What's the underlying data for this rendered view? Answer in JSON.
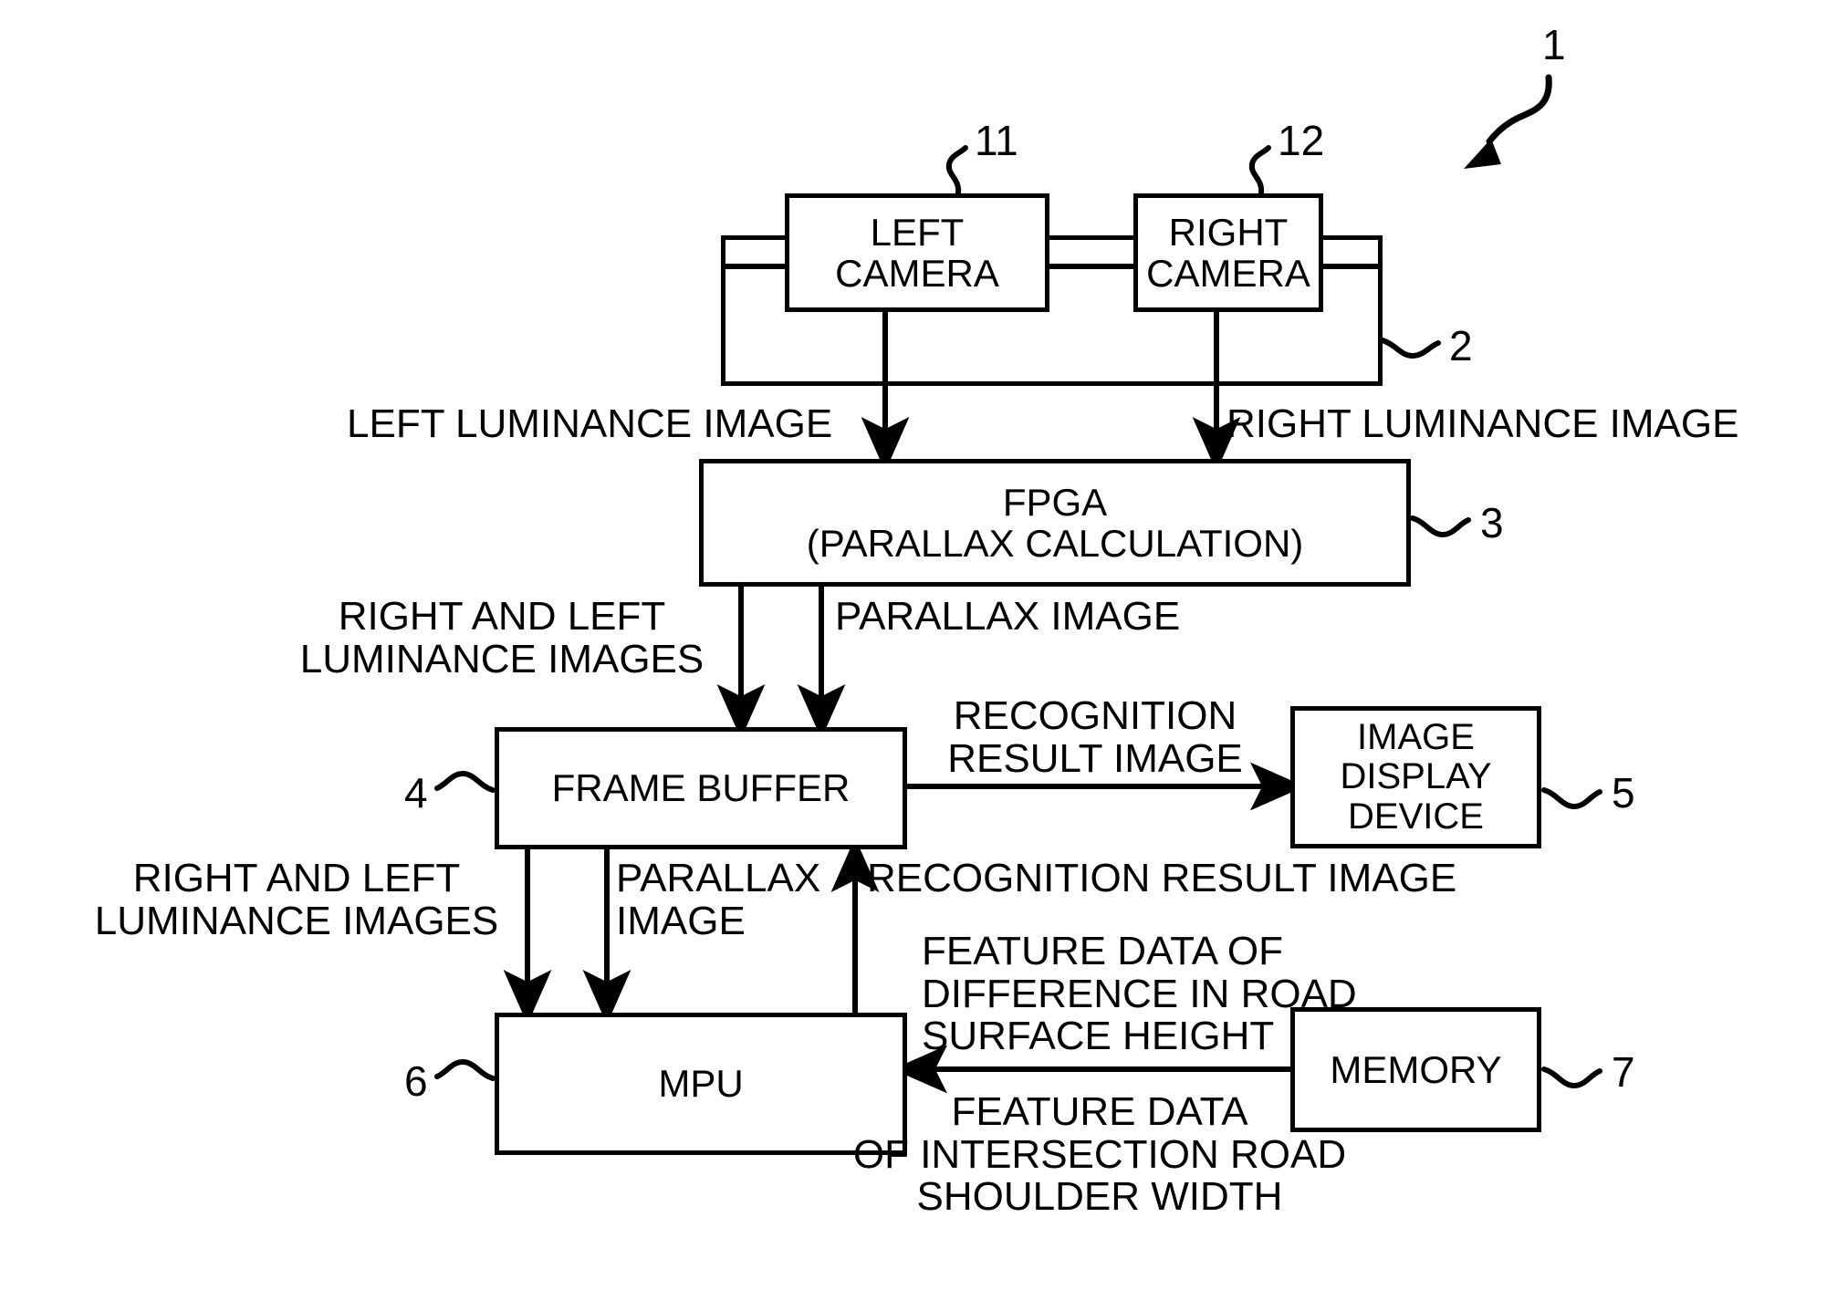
{
  "figure": {
    "system_ref": "1",
    "camera_unit_ref": "2",
    "fpga_ref": "3",
    "frame_buffer_ref": "4",
    "display_ref": "5",
    "mpu_ref": "6",
    "memory_ref": "7",
    "left_camera_ref": "11",
    "right_camera_ref": "12"
  },
  "blocks": {
    "left_camera": {
      "line1": "LEFT",
      "line2": "CAMERA"
    },
    "right_camera": {
      "line1": "RIGHT",
      "line2": "CAMERA"
    },
    "fpga": {
      "line1": "FPGA",
      "line2": "(PARALLAX CALCULATION)"
    },
    "frame_buffer": {
      "line1": "FRAME BUFFER"
    },
    "image_display_device": {
      "line1": "IMAGE",
      "line2": "DISPLAY",
      "line3": "DEVICE"
    },
    "mpu": {
      "line1": "MPU"
    },
    "memory": {
      "line1": "MEMORY"
    }
  },
  "edge_labels": {
    "left_luminance_image": "LEFT LUMINANCE IMAGE",
    "right_luminance_image": "RIGHT LUMINANCE IMAGE",
    "right_and_left_luminance_images_top": "RIGHT AND LEFT\nLUMINANCE IMAGES",
    "parallax_image_top": "PARALLAX IMAGE",
    "recognition_result_image_to_display": "RECOGNITION\nRESULT IMAGE",
    "right_and_left_luminance_images_bottom": "RIGHT AND LEFT\nLUMINANCE IMAGES",
    "parallax_image_bottom": "PARALLAX\nIMAGE",
    "recognition_result_image_up": "RECOGNITION RESULT IMAGE",
    "feature_data_road_surface_height": "FEATURE DATA OF\nDIFFERENCE IN ROAD\nSURFACE HEIGHT",
    "feature_data_intersection_shoulder_width": "FEATURE DATA\nOF INTERSECTION ROAD\nSHOULDER WIDTH"
  },
  "colors": {
    "stroke": "#000000",
    "background": "#ffffff"
  }
}
